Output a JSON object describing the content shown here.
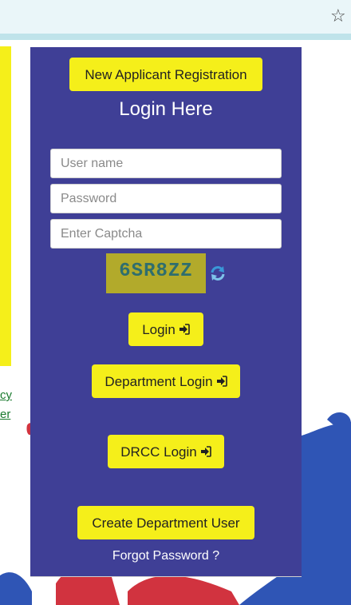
{
  "browser": {
    "bookmark_icon": "star-outline-icon"
  },
  "side": {
    "link_1": "cy",
    "link_2": "er"
  },
  "login": {
    "registration_button": "New Applicant Registration",
    "title": "Login Here",
    "username_placeholder": "User name",
    "password_placeholder": "Password",
    "captcha_placeholder": "Enter Captcha",
    "captcha_text": "6SR8ZZ",
    "refresh_icon": "refresh-icon",
    "login_button": "Login",
    "department_login_button": "Department Login",
    "drcc_login_button": "DRCC Login",
    "create_user_button": "Create Department User",
    "forgot_password": "Forgot Password ?",
    "signin_icon": "sign-in-icon"
  },
  "colors": {
    "card_background": "#3f3f96",
    "button_yellow": "#f5ef1a",
    "captcha_background": "#b2aa2b",
    "blob_blue": "#2f55b5",
    "blob_red": "#d1333f"
  }
}
